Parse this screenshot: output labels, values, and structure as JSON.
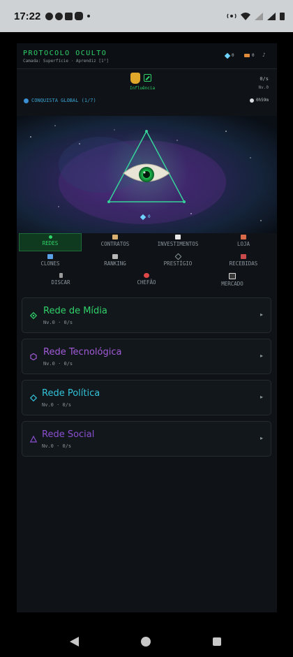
{
  "status_bar": {
    "time": "17:22"
  },
  "header": {
    "brand": "PROTOCOLO OCULTO",
    "subtitle": "Camada: Superfície · Aprendiz [1°]",
    "gems": "0",
    "weapons": "0",
    "music_icon": "music-note-icon"
  },
  "influence": {
    "label": "Influência",
    "rate": "0/s",
    "level": "Nv.0"
  },
  "conquest": {
    "label": "CONQUISTA GLOBAL (1/7)",
    "timer": "0h59m"
  },
  "banner": {
    "gem_count": "0"
  },
  "tabs": {
    "row1": [
      {
        "label": "REDES",
        "active": true
      },
      {
        "label": "CONTRATOS"
      },
      {
        "label": "INVESTIMENTOS"
      },
      {
        "label": "LOJA"
      }
    ],
    "row2": [
      {
        "label": "CLONES"
      },
      {
        "label": "RANKING"
      },
      {
        "label": "PRESTÍGIO"
      },
      {
        "label": "RECEBIDAS"
      }
    ],
    "row3": [
      {
        "label": "DISCAR"
      },
      {
        "label": "CHEFÃO"
      },
      {
        "label": "MERCADO"
      }
    ]
  },
  "networks": [
    {
      "name": "Rede de Mídia",
      "stats": "Nv.0 · 0/s",
      "color": "#2fd36a"
    },
    {
      "name": "Rede Tecnológica",
      "stats": "Nv.0 · 0/s",
      "color": "#a25bd8"
    },
    {
      "name": "Rede Política",
      "stats": "Nv.0 · 0/s",
      "color": "#32c3d9"
    },
    {
      "name": "Rede Social",
      "stats": "Nv.0 · 0/s",
      "color": "#8a4fd0"
    }
  ],
  "colors": {
    "accent": "#2fd36a",
    "background": "#0f1317"
  }
}
